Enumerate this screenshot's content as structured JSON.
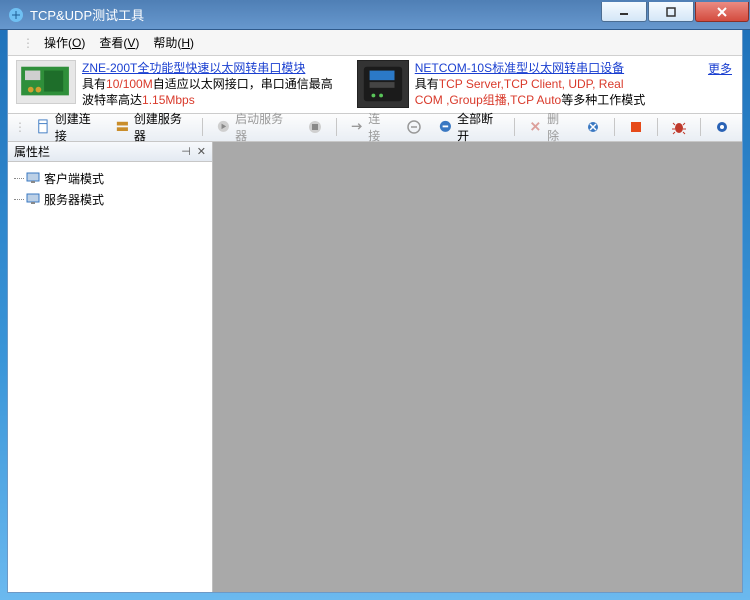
{
  "window": {
    "title": "TCP&UDP测试工具"
  },
  "menus": {
    "op": "操作(<u>O</u>)",
    "view": "查看(<u>V</u>)",
    "help": "帮助(<u>H</u>)"
  },
  "ad": {
    "p1": {
      "title": "ZNE-200T全功能型快速以太网转串口模块",
      "line1_pre": "具有",
      "line1_hl": "10/100M",
      "line1_post": "自适应以太网接口，串口通信最高",
      "line2_pre": "波特率高达",
      "line2_hl": "1.15Mbps"
    },
    "p2": {
      "title": "NETCOM-10S标准型以太网转串口设备",
      "line1_pre": "具有",
      "line1_hl": "TCP Server,TCP Client, UDP, Real",
      "line2_hl": "COM ,Group组播,TCP Auto",
      "line2_post": "等多种工作模式"
    },
    "more": "更多"
  },
  "toolbar": {
    "create_conn": "创建连接",
    "create_server": "创建服务器",
    "start_server": "启动服务器",
    "connect": "连接",
    "disconnect_all": "全部断开",
    "delete": "删除"
  },
  "panel": {
    "title": "属性栏"
  },
  "tree": {
    "client": "客户端模式",
    "server": "服务器模式"
  }
}
